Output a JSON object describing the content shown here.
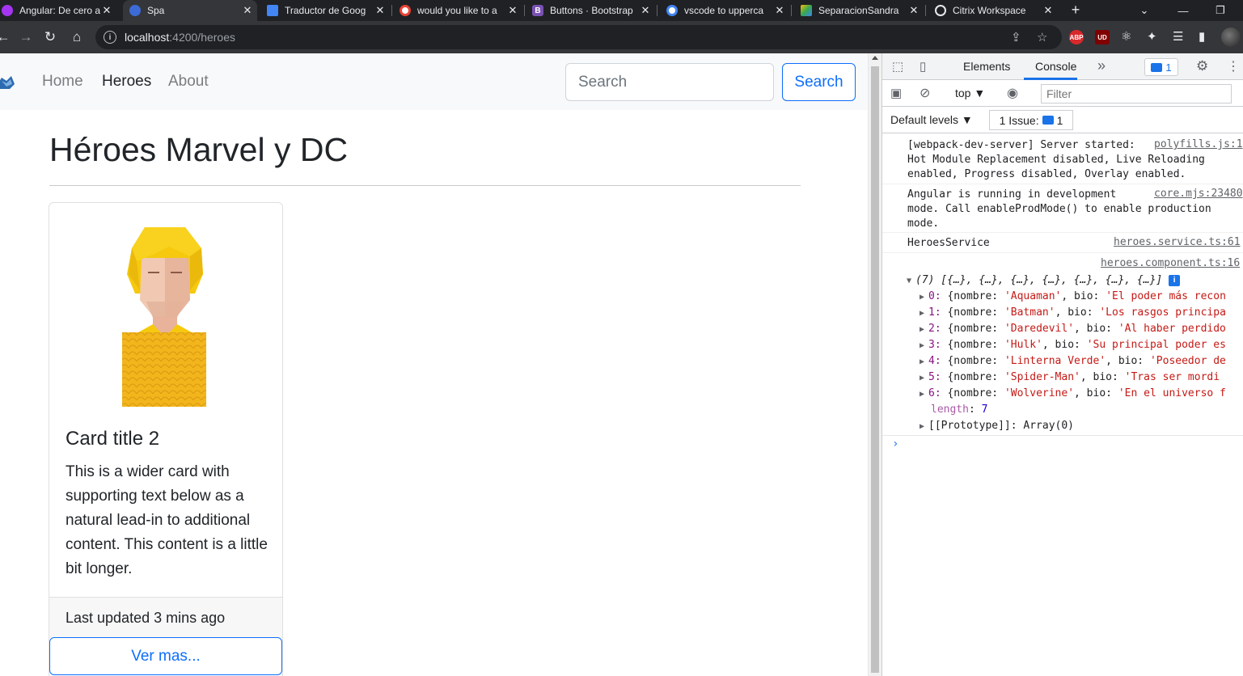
{
  "browser": {
    "tabs": [
      {
        "title": "Angular: De cero a",
        "icon": "udemy-icon",
        "color": "#a435f0"
      },
      {
        "title": "Spa",
        "icon": "angular-icon",
        "color": "#3c6bd8",
        "active": true
      },
      {
        "title": "Traductor de Goog",
        "icon": "google-translate-icon",
        "color": "#4285f4"
      },
      {
        "title": "would you like to a",
        "icon": "google-icon",
        "color": "#ffffff"
      },
      {
        "title": "Buttons · Bootstrap",
        "icon": "bootstrap-icon",
        "color": "#7952b3"
      },
      {
        "title": "vscode to upperca",
        "icon": "google-icon",
        "color": "#ffffff"
      },
      {
        "title": "SeparacionSandra",
        "icon": "google-drive-icon",
        "color": "#fbbc04"
      },
      {
        "title": "Citrix Workspace",
        "icon": "citrix-icon",
        "color": "#e8eaed"
      }
    ],
    "url_host": "localhost",
    "url_path": ":4200/heroes",
    "extensions": [
      "ABP",
      "UD"
    ]
  },
  "page": {
    "nav": {
      "links": [
        "Home",
        "Heroes",
        "About"
      ],
      "search_placeholder": "Search",
      "search_button": "Search"
    },
    "title": "Héroes Marvel y DC",
    "card": {
      "title": "Card title 2",
      "text": "This is a wider card with supporting text below as a natural lead-in to additional content. This content is a little bit longer.",
      "footer": "Last updated 3 mins ago",
      "button": "Ver mas..."
    }
  },
  "devtools": {
    "tabs": [
      "Elements",
      "Console"
    ],
    "more": "»",
    "issue_badge": "1",
    "context": "top",
    "filter_placeholder": "Filter",
    "levels": "Default levels",
    "issues_label": "1 Issue:",
    "issues_count": "1",
    "messages": [
      {
        "text": "[webpack-dev-server] Server started:\nHot Module Replacement disabled, Live Reloading\nenabled, Progress disabled, Overlay enabled.",
        "source": "polyfills.js:1"
      },
      {
        "text": "Angular is running in development\nmode. Call enableProdMode() to enable production\nmode.",
        "source": "core.mjs:23480"
      },
      {
        "text": "HeroesService",
        "source": "heroes.service.ts:61"
      }
    ],
    "array_source": "heroes.component.ts:16",
    "array_summary": "(7) [{…}, {…}, {…}, {…}, {…}, {…}, {…}]",
    "entries": [
      {
        "index": "0",
        "nombre": "'Aquaman'",
        "bio": "'El poder más recon"
      },
      {
        "index": "1",
        "nombre": "'Batman'",
        "bio": "'Los rasgos principa"
      },
      {
        "index": "2",
        "nombre": "'Daredevil'",
        "bio": "'Al haber perdido"
      },
      {
        "index": "3",
        "nombre": "'Hulk'",
        "bio": "'Su principal poder es"
      },
      {
        "index": "4",
        "nombre": "'Linterna Verde'",
        "bio": "'Poseedor de"
      },
      {
        "index": "5",
        "nombre": "'Spider-Man'",
        "bio": "'Tras ser mordi"
      },
      {
        "index": "6",
        "nombre": "'Wolverine'",
        "bio": "'En el universo f"
      }
    ],
    "length_key": "length",
    "length_value": "7",
    "prototype": "[[Prototype]]: Array(0)"
  }
}
